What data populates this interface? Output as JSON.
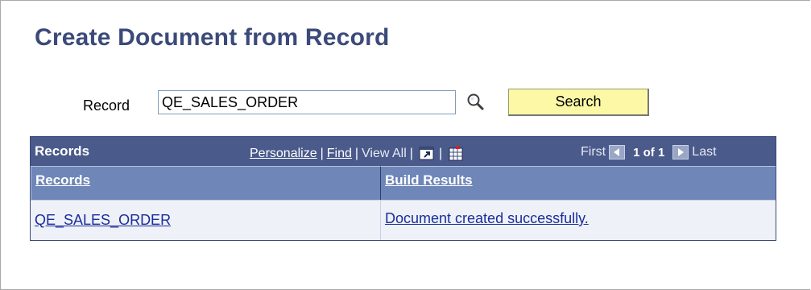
{
  "page": {
    "title": "Create Document from Record"
  },
  "search": {
    "record_label": "Record",
    "record_value": "QE_SALES_ORDER",
    "lookup_icon": "magnifier-icon",
    "button_label": "Search",
    "button_color": "#fcf8a6"
  },
  "grid": {
    "title": "Records",
    "header_color": "#4a5a8b",
    "nav": {
      "personalize": "Personalize",
      "find": "Find",
      "view_all": "View All",
      "zoom_icon": "zoom-window-icon",
      "download_icon": "download-grid-icon"
    },
    "pager": {
      "first": "First",
      "count": "1 of 1",
      "last": "Last"
    },
    "columns": [
      "Records",
      "Build Results"
    ],
    "rows": [
      [
        "QE_SALES_ORDER",
        "Document created successfully."
      ]
    ]
  }
}
